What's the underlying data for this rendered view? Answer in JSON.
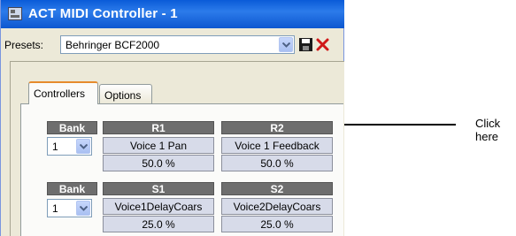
{
  "window": {
    "title": "ACT MIDI Controller - 1"
  },
  "presets": {
    "label": "Presets:",
    "value": "Behringer BCF2000"
  },
  "tabs": [
    {
      "label": "Controllers"
    },
    {
      "label": "Options"
    }
  ],
  "row1": {
    "bank_header": "Bank",
    "bank_value": "1",
    "controls": [
      {
        "header": "R1",
        "name": "Voice 1 Pan",
        "value": "50.0 %"
      },
      {
        "header": "R2",
        "name": "Voice 1 Feedback",
        "value": "50.0 %"
      }
    ]
  },
  "row2": {
    "bank_header": "Bank",
    "bank_value": "1",
    "controls": [
      {
        "header": "S1",
        "name": "Voice1DelayCoars",
        "value": "25.0 %"
      },
      {
        "header": "S2",
        "name": "Voice2DelayCoars",
        "value": "25.0 %"
      }
    ]
  },
  "callout": {
    "text": "Click here"
  },
  "icons": {
    "app": "midi-app-icon",
    "dropdown": "chevron-down-icon",
    "save": "floppy-disk-icon",
    "delete": "red-x-icon"
  },
  "colors": {
    "titlebar": "#0a5bd8",
    "header_cell": "#6e6e6e",
    "value_cell": "#d7dbe9",
    "delete_red": "#d01818"
  }
}
